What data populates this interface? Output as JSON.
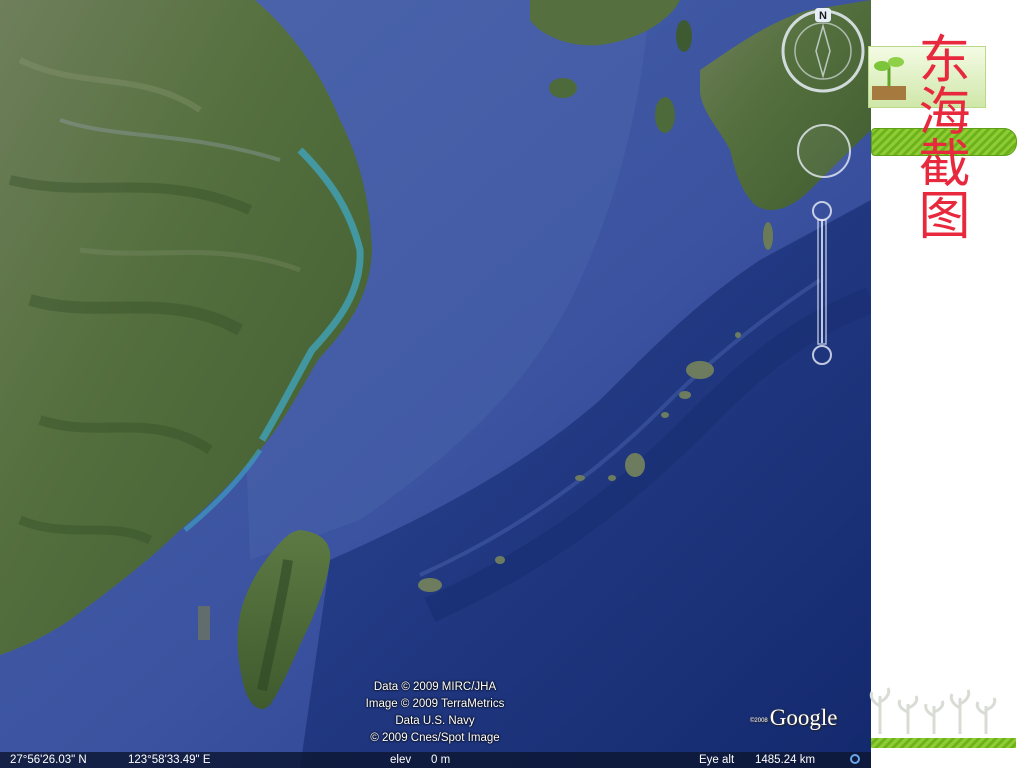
{
  "page": {
    "title": "东海截图"
  },
  "map": {
    "attribution": [
      "Data © 2009 MIRC/JHA",
      "Image © 2009 TerraMetrics",
      "Data U.S. Navy",
      "© 2009 Cnes/Spot Image"
    ],
    "logo": {
      "small": "©2008",
      "word": "Google"
    }
  },
  "statusbar": {
    "latitude": "27°56'26.03\" N",
    "longitude": "123°58'33.49\" E",
    "elevation_label": "elev",
    "elevation_value": "0 m",
    "eye_alt_label": "Eye alt",
    "eye_alt_value": "1485.24 km"
  },
  "nav": {
    "compass_north": "N"
  },
  "icons": {
    "compass": "compass-icon",
    "look": "look-joystick-icon",
    "zoom": "zoom-slider-icon",
    "streaming": "streaming-indicator-icon",
    "sprout": "sprout-icon"
  },
  "colors": {
    "title": "#e8283c",
    "accent_green": "#7cbf28",
    "ocean": "#3c55a0",
    "land": "#4f6b3c"
  }
}
